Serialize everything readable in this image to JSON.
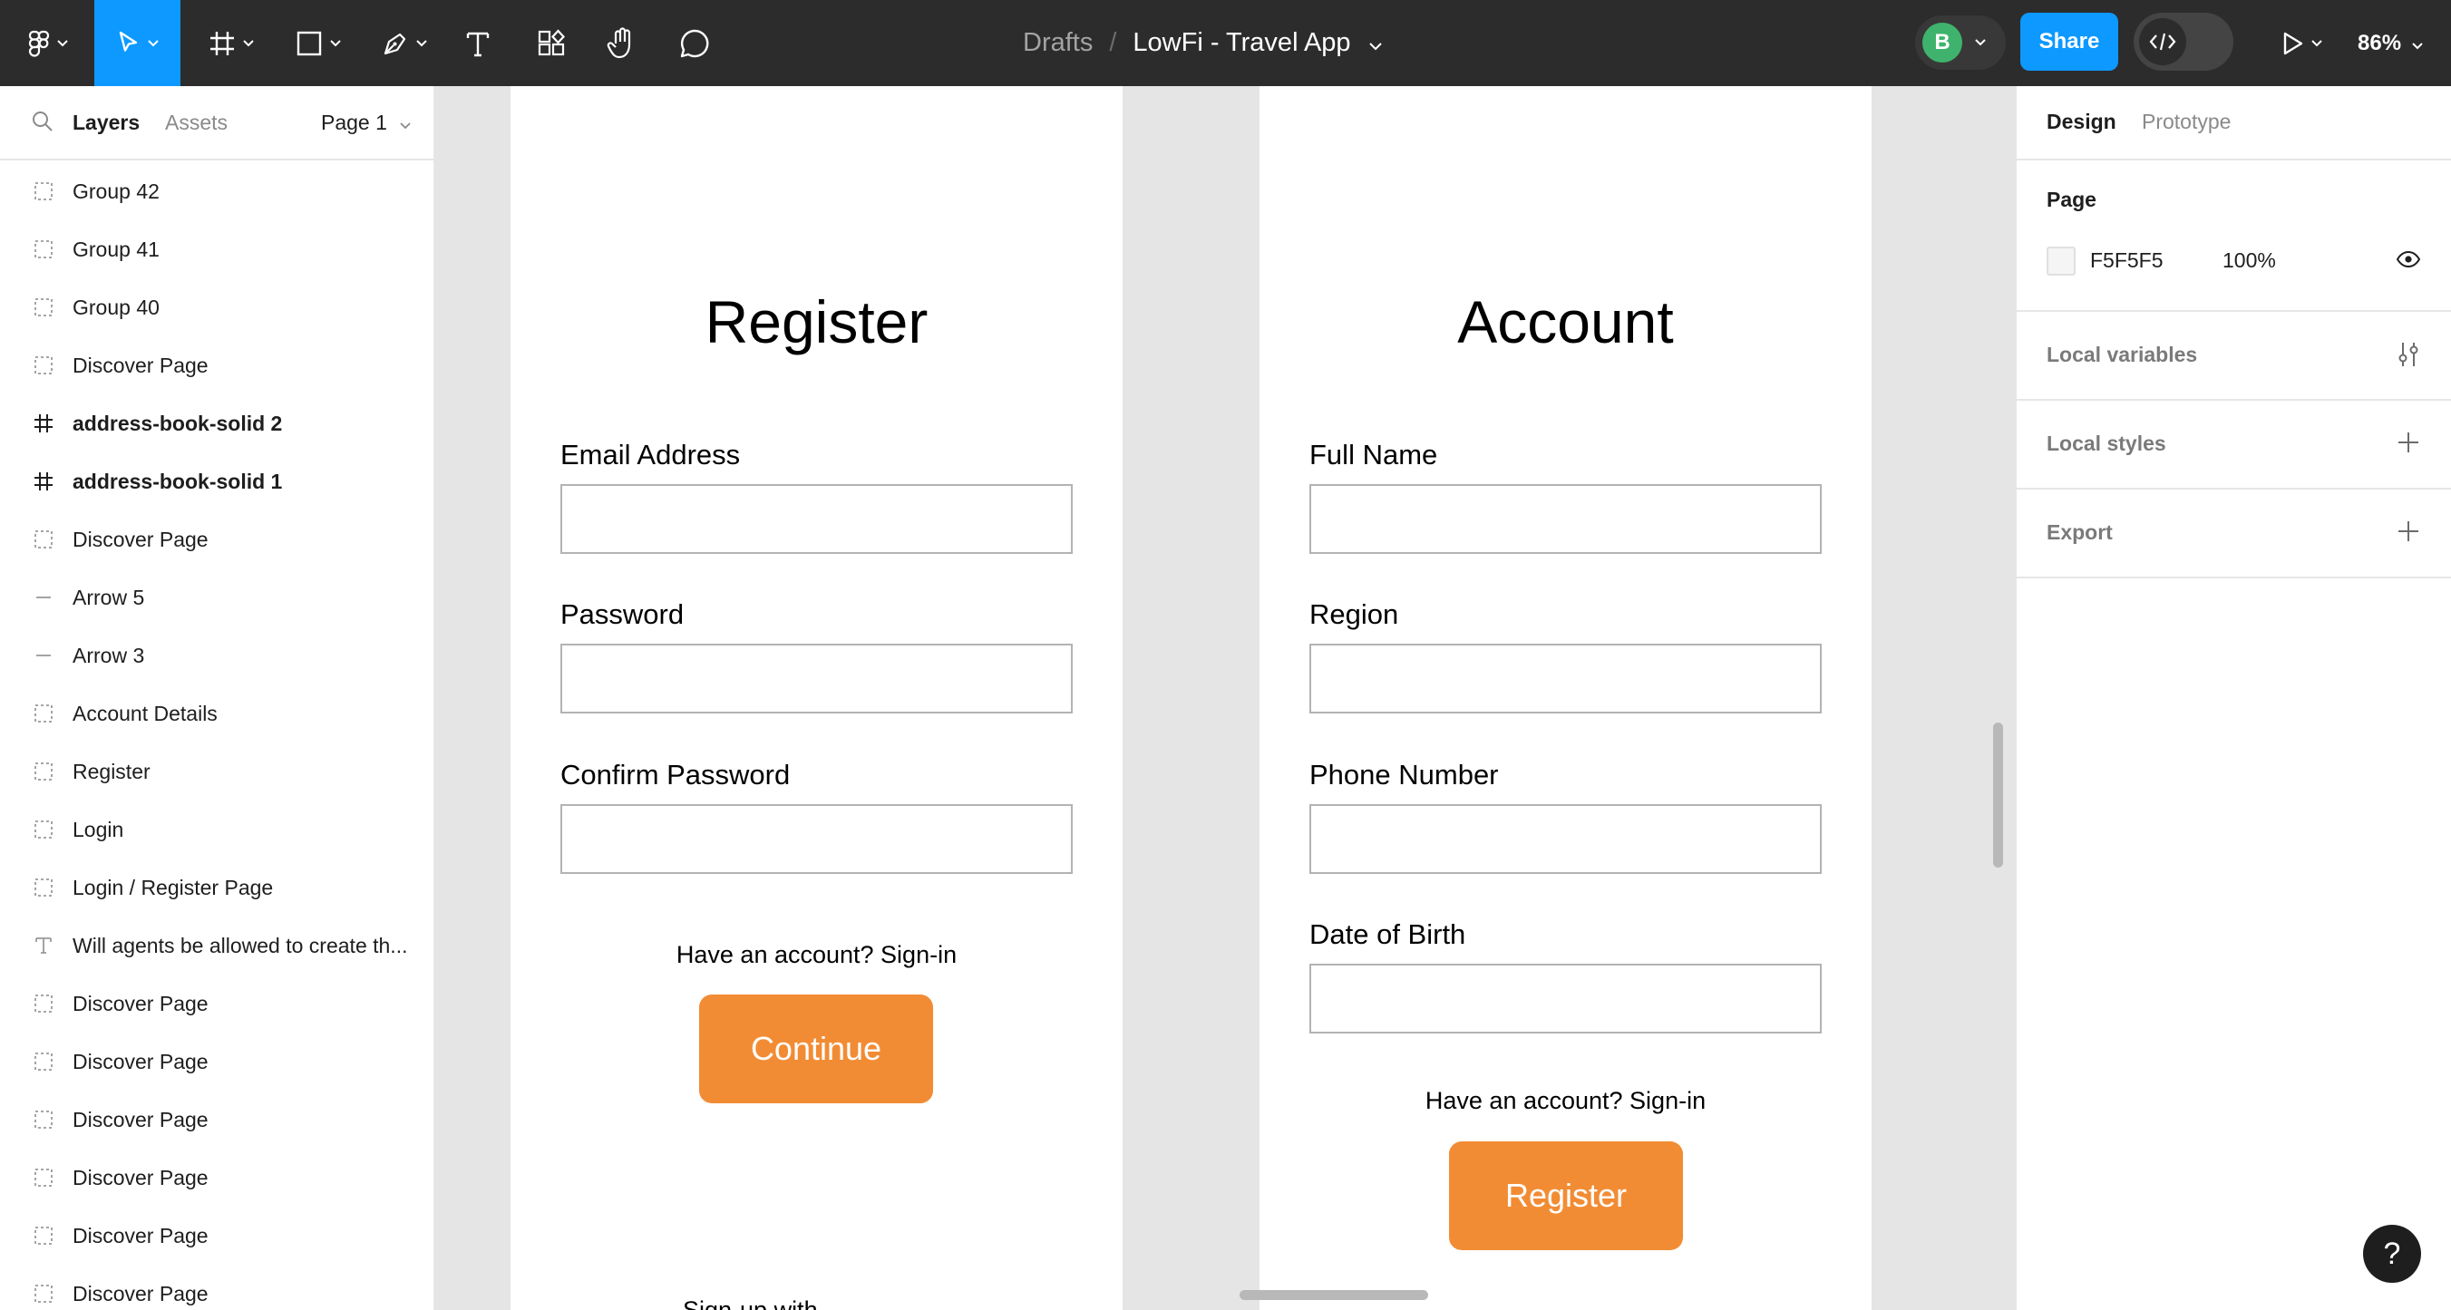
{
  "toolbar": {
    "breadcrumb_root": "Drafts",
    "separator": "/",
    "file_name": "LowFi - Travel App",
    "avatar_initial": "B",
    "share_label": "Share",
    "zoom_label": "86%",
    "accent_color": "#0d99ff"
  },
  "left_panel": {
    "tab_layers": "Layers",
    "tab_assets": "Assets",
    "page_selector": "Page 1",
    "layers": [
      {
        "name": "Group 42",
        "icon": "group-icon"
      },
      {
        "name": "Group 41",
        "icon": "group-icon"
      },
      {
        "name": "Group 40",
        "icon": "group-icon"
      },
      {
        "name": "Discover Page",
        "icon": "group-icon"
      },
      {
        "name": "address-book-solid 2",
        "icon": "frame-icon"
      },
      {
        "name": "address-book-solid 1",
        "icon": "frame-icon"
      },
      {
        "name": "Discover Page",
        "icon": "group-icon"
      },
      {
        "name": "Arrow 5",
        "icon": "line-icon"
      },
      {
        "name": "Arrow 3",
        "icon": "line-icon"
      },
      {
        "name": "Account Details",
        "icon": "group-icon"
      },
      {
        "name": "Register",
        "icon": "group-icon"
      },
      {
        "name": "Login",
        "icon": "group-icon"
      },
      {
        "name": "Login / Register Page",
        "icon": "group-icon"
      },
      {
        "name": "Will agents be allowed to create th...",
        "icon": "text-icon"
      },
      {
        "name": "Discover Page",
        "icon": "group-icon"
      },
      {
        "name": "Discover Page",
        "icon": "group-icon"
      },
      {
        "name": "Discover Page",
        "icon": "group-icon"
      },
      {
        "name": "Discover Page",
        "icon": "group-icon"
      },
      {
        "name": "Discover Page",
        "icon": "group-icon"
      },
      {
        "name": "Discover Page",
        "icon": "group-icon"
      }
    ]
  },
  "canvas": {
    "register_frame": {
      "title": "Register",
      "fields": [
        "Email Address",
        "Password",
        "Confirm Password"
      ],
      "note": "Have an account? Sign-in",
      "button": "Continue",
      "cut_text": "Sign-up with"
    },
    "account_frame": {
      "title": "Account",
      "fields": [
        "Full Name",
        "Region",
        "Phone Number",
        "Date of Birth"
      ],
      "note": "Have an account? Sign-in",
      "button": "Register"
    },
    "button_color": "#f28c34"
  },
  "right_panel": {
    "tab_design": "Design",
    "tab_prototype": "Prototype",
    "page_section_title": "Page",
    "page_color_hex": "F5F5F5",
    "page_color_opacity": "100%",
    "local_variables": "Local variables",
    "local_styles": "Local styles",
    "export": "Export",
    "help_label": "?"
  }
}
